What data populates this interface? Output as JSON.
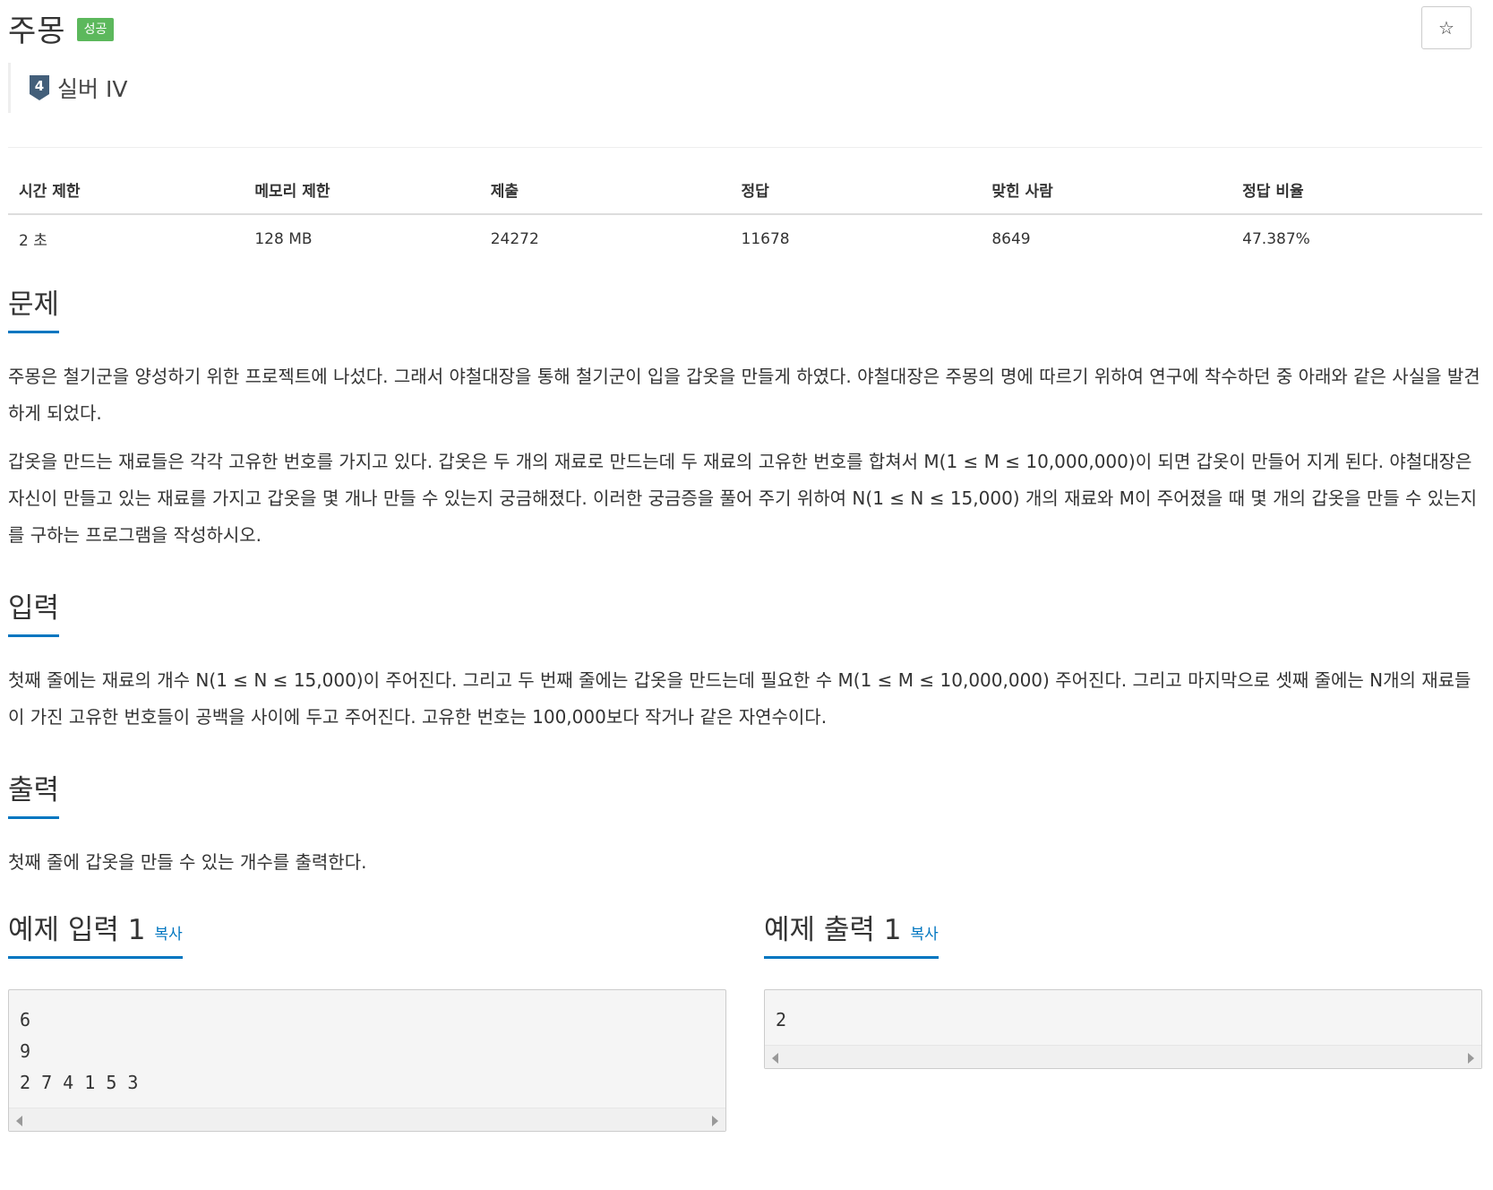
{
  "problem": {
    "title": "주몽",
    "status_badge": "성공",
    "star_icon": "☆",
    "tier": {
      "number": "4",
      "name": "실버 IV"
    }
  },
  "stats": {
    "headers": [
      "시간 제한",
      "메모리 제한",
      "제출",
      "정답",
      "맞힌 사람",
      "정답 비율"
    ],
    "values": [
      "2 초",
      "128 MB",
      "24272",
      "11678",
      "8649",
      "47.387%"
    ]
  },
  "sections": {
    "problem": {
      "heading": "문제",
      "paragraphs": [
        "주몽은 철기군을 양성하기 위한 프로젝트에 나섰다. 그래서 야철대장을 통해 철기군이 입을 갑옷을 만들게 하였다. 야철대장은 주몽의 명에 따르기 위하여 연구에 착수하던 중 아래와 같은 사실을 발견하게 되었다.",
        "갑옷을 만드는 재료들은 각각 고유한 번호를 가지고 있다. 갑옷은 두 개의 재료로 만드는데 두 재료의 고유한 번호를 합쳐서 M(1 ≤ M ≤ 10,000,000)이 되면 갑옷이 만들어 지게 된다. 야철대장은 자신이 만들고 있는 재료를 가지고 갑옷을 몇 개나 만들 수 있는지 궁금해졌다. 이러한 궁금증을 풀어 주기 위하여 N(1 ≤ N ≤ 15,000) 개의 재료와 M이 주어졌을 때 몇 개의 갑옷을 만들 수 있는지를 구하는 프로그램을 작성하시오."
      ]
    },
    "input": {
      "heading": "입력",
      "text": "첫째 줄에는 재료의 개수 N(1 ≤ N ≤ 15,000)이 주어진다. 그리고 두 번째 줄에는 갑옷을 만드는데 필요한 수 M(1 ≤ M ≤ 10,000,000) 주어진다. 그리고 마지막으로 셋째 줄에는 N개의 재료들이 가진 고유한 번호들이 공백을 사이에 두고 주어진다. 고유한 번호는 100,000보다 작거나 같은 자연수이다."
    },
    "output": {
      "heading": "출력",
      "text": "첫째 줄에 갑옷을 만들 수 있는 개수를 출력한다."
    }
  },
  "samples": {
    "input": {
      "heading": "예제 입력 1",
      "copy_label": "복사",
      "content": "6\n9\n2 7 4 1 5 3"
    },
    "output": {
      "heading": "예제 출력 1",
      "copy_label": "복사",
      "content": "2"
    }
  },
  "colors": {
    "success": "#5cb85c",
    "accent": "#0076c0",
    "tier_silver": "#435f7a"
  }
}
